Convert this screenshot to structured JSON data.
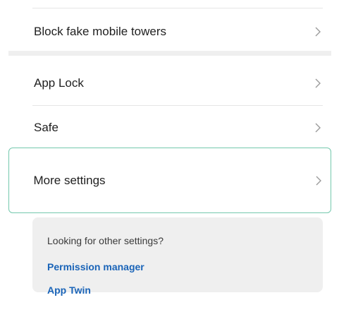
{
  "settings_list": {
    "items": [
      {
        "label": "Block fake mobile towers"
      },
      {
        "label": "App Lock"
      },
      {
        "label": "Safe"
      },
      {
        "label": "More settings"
      }
    ]
  },
  "info_card": {
    "title": "Looking for other settings?",
    "links": [
      {
        "label": "Permission manager"
      },
      {
        "label": "App Twin"
      }
    ]
  },
  "colors": {
    "link": "#1a64b8",
    "highlight_border": "#74c8ad",
    "card_background": "#efefef"
  },
  "icons": {
    "row_arrow": "chevron-right-icon"
  }
}
